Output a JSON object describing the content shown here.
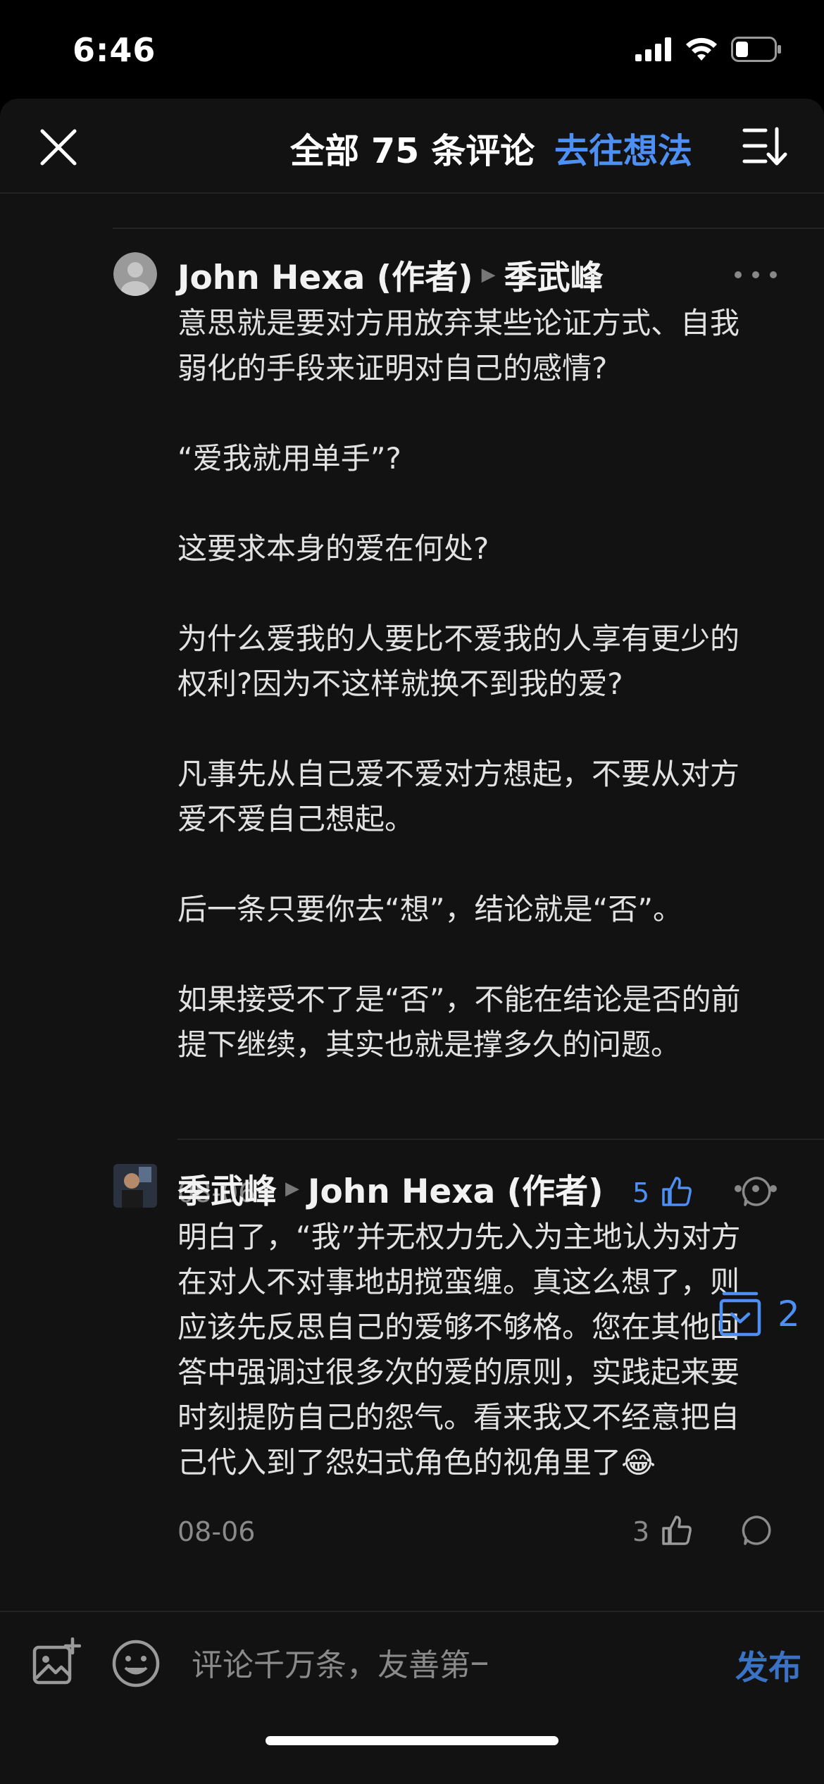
{
  "status_bar": {
    "time": "6:46",
    "icons": [
      "signal-icon",
      "wifi-icon",
      "battery-icon"
    ]
  },
  "header": {
    "title": "全部 75 条评论",
    "goto_thoughts": "去往想法",
    "close_icon": "close-icon",
    "sort_icon": "sort-icon"
  },
  "comments": [
    {
      "author": "John Hexa (作者)",
      "reply_to": "季武峰",
      "paragraphs": [
        "意思就是要对方用放弃某些论证方式、自我弱化的手段来证明对自己的感情?",
        "“爱我就用单手”?",
        "这要求本身的爱在何处?",
        "为什么爱我的人要比不爱我的人享有更少的权利?因为不这样就换不到我的爱?",
        "凡事先从自己爱不爱对方想起，不要从对方爱不爱自己想起。",
        "后一条只要你去“想”，结论就是“否”。",
        "如果接受不了是“否”，不能在结论是否的前提下继续，其实也就是撑多久的问题。"
      ],
      "date": "08-06",
      "likes": "5",
      "liked": true
    },
    {
      "author": "季武峰",
      "reply_to": "John Hexa (作者)",
      "paragraphs": [
        "明白了，“我”并无权力先入为主地认为对方在对人不对事地胡搅蛮缠。真这么想了，则应该先反思自己的爱够不够格。您在其他回答中强调过很多次的爱的原则，实践起来要时刻提防自己的怨气。看来我又不经意把自己代入到了怨妇式角色的视角里了"
      ],
      "emoji": "😂",
      "date": "08-06",
      "likes": "3",
      "liked": false
    }
  ],
  "floating_badge": {
    "count": "2",
    "icon": "collapse-replies-icon"
  },
  "input_bar": {
    "placeholder": "评论千万条，友善第一条",
    "publish_label": "发布"
  },
  "colors": {
    "accent": "#4d8ff2",
    "background": "#121212",
    "text": "#e2e2e2",
    "muted": "#8a8a8a"
  }
}
